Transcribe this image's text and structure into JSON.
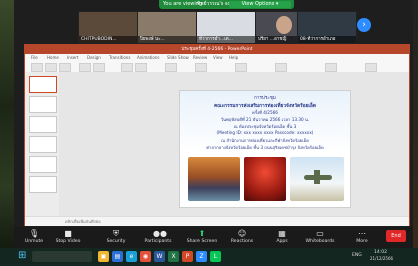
{
  "zoom": {
    "share_bar_text": "You are viewing ",
    "share_bar_name": "ทิพย์วรรณ's screen",
    "view_options_label": "View Options",
    "participants": [
      {
        "name": "CHITPUBODIN...",
        "bg": "#5b4a3a"
      },
      {
        "name": "ปิยพงษ์ นะ...",
        "bg": "#8a7a6a"
      },
      {
        "name": "ที่ว่าการอำ...เต...",
        "bg": "#d9dde3"
      },
      {
        "name": "ปรียา ...อาชญิ",
        "bg": "#4a4a52"
      },
      {
        "name": "08-ที่ว่าการอำเภอ",
        "bg": "#2f3a44"
      }
    ],
    "next_icon": "chevron-right-icon",
    "toolbar": [
      {
        "label": "Unmute",
        "icon": "microphone-icon",
        "glyph": "🎙"
      },
      {
        "label": "Stop Video",
        "icon": "video-icon",
        "glyph": "▶"
      },
      {
        "label": "Security",
        "icon": "shield-icon",
        "glyph": "⛨"
      },
      {
        "label": "Participants",
        "icon": "participants-icon",
        "glyph": "👥"
      },
      {
        "label": "Share Screen",
        "icon": "share-screen-icon",
        "glyph": "⬆"
      },
      {
        "label": "Reactions",
        "icon": "reactions-icon",
        "glyph": "☺"
      },
      {
        "label": "Apps",
        "icon": "apps-icon",
        "glyph": "▦"
      },
      {
        "label": "Whiteboards",
        "icon": "whiteboard-icon",
        "glyph": "▭"
      },
      {
        "label": "More",
        "icon": "more-icon",
        "glyph": "⋯"
      }
    ],
    "end_label": "End"
  },
  "powerpoint": {
    "title": "ประชุมครั้งที่ 4-2566 - PowerPoint",
    "ribbon_tabs": [
      "File",
      "Home",
      "Insert",
      "Design",
      "Transitions",
      "Animations",
      "Slide Show",
      "Review",
      "View",
      "Help"
    ],
    "slide_lines": [
      "การประชุม",
      "คณะกรรมการส่งเสริมการท่องเที่ยวจังหวัดร้อยเอ็ด",
      "ครั้งที่ 4/2566",
      "วันพฤหัสบดีที่ 21 ธันวาคม 2566 เวลา 13.30 น.",
      "ณ ห้องประชุมจังหวัดร้อยเอ็ด ชั้น 3",
      "(Meeting ID: xxx xxxx xxxx Passcode: xxxxxx)",
      "ณ สำนักงานการท่องเที่ยวและกีฬาจังหวัดร้อยเอ็ด",
      "ศาลากลางจังหวัดร้อยเอ็ด ชั้น 3 ถนนสุริยเดชบำรุง จังหวัดร้อยเอ็ด"
    ],
    "notes_placeholder": "คลิกเพื่อเพิ่มบันทึกย่อ"
  },
  "taskbar": {
    "start_icon": "windows-start-icon",
    "apps": [
      {
        "icon": "file-explorer-icon",
        "color": "#f2b632",
        "glyph": "▣"
      },
      {
        "icon": "store-icon",
        "color": "#2b6fd6",
        "glyph": "▤"
      },
      {
        "icon": "edge-icon",
        "color": "#1a9fd6",
        "glyph": "e"
      },
      {
        "icon": "chrome-icon",
        "color": "#e5503a",
        "glyph": "◉"
      },
      {
        "icon": "word-icon",
        "color": "#2b579a",
        "glyph": "W"
      },
      {
        "icon": "excel-icon",
        "color": "#217346",
        "glyph": "X"
      },
      {
        "icon": "powerpoint-icon",
        "color": "#d24726",
        "glyph": "P"
      },
      {
        "icon": "zoom-icon",
        "color": "#2d8cff",
        "glyph": "Z"
      },
      {
        "icon": "line-icon",
        "color": "#06c755",
        "glyph": "L"
      }
    ],
    "tray_lang": "ENG",
    "clock_time": "14:02",
    "clock_date": "21/12/2566"
  },
  "colors": {
    "ppt_accent": "#b7472a",
    "zoom_green": "#1f8a3a",
    "end_red": "#e02828"
  }
}
